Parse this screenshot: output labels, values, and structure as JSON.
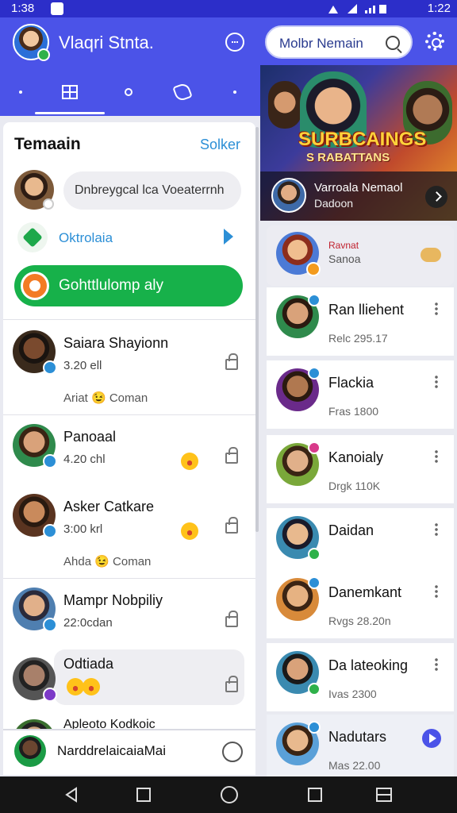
{
  "status_bar": {
    "time_left": "1:38",
    "time_right": "1:22"
  },
  "header": {
    "user_name": "Vlaqri Stnta.",
    "search_placeholder": "Molbr Nemain"
  },
  "left_panel": {
    "title": "Temaain",
    "action": "Solker",
    "status_prompt": "Dnbreygcal lca Voeaterrnh",
    "link_label": "Oktrolaia",
    "green_button": "Gohttlulomp aly",
    "chats": [
      {
        "name": "Saiara Shayionn",
        "sub": "3.20 ell",
        "preview": "Ariat 😉 Coman",
        "dot": "#2c8fd6",
        "av_skin": "#7a4a2e",
        "av_bg": "#3a2a1c"
      },
      {
        "name": "Panoaal",
        "sub": "4.20 chl",
        "preview": "",
        "dot": "#2c8fd6",
        "av_skin": "#d9a27a",
        "av_bg": "#2f8a4c"
      },
      {
        "name": "Asker Catkare",
        "sub": "3:00 krl",
        "preview": "Ahda 😉 Coman",
        "dot": "#2c8fd6",
        "av_skin": "#c98a5c",
        "av_bg": "#5a3420"
      },
      {
        "name": "Mampr Nobpiliy",
        "sub": "22:0cdan",
        "preview": "",
        "dot": "#2c8fd6",
        "av_skin": "#e1b08a",
        "av_bg": "#4f7fb0"
      },
      {
        "name": "Odtiada",
        "sub": "",
        "preview": "",
        "dot": "#7d3ac8",
        "av_skin": "#a8806a",
        "av_bg": "#555"
      },
      {
        "name": "Apleoto Kodkoic",
        "sub": "",
        "preview": "",
        "dot": "#2fb14a",
        "av_skin": "#c9a07a",
        "av_bg": "#3a6f2f"
      }
    ],
    "bottom_text": "NarddrelaicaiaMai"
  },
  "banner": {
    "title": "SURBCAINGS",
    "subtitle": "S RABATTANS",
    "channel_name": "Varroala Nemaol",
    "channel_sub": "Dadoon"
  },
  "featured": {
    "tag": "Ravnat",
    "sub": "Sanoa"
  },
  "right_list": [
    {
      "name": "Ran lliehent",
      "sub": "Relc 295.17",
      "dot": "#2c8fd6",
      "skin": "#d9a27a",
      "bg": "#2f8a4c"
    },
    {
      "name": "Flackia",
      "sub": "Fras 1800",
      "dot": "#2c8fd6",
      "skin": "#b07850",
      "bg": "#6a2a8a"
    },
    {
      "name": "Kanoialy",
      "sub": "Drgk 110K",
      "dot": "#d83a8a",
      "skin": "#e1b08a",
      "bg": "#7aa83a"
    },
    {
      "name": "Daidan",
      "sub": "",
      "dot": "#2fb14a",
      "skin": "#e8b98e",
      "bg": "#3a8ab0"
    },
    {
      "name": "Danemkant",
      "sub": "Rvgs 28.20n",
      "dot": "#2c8fd6",
      "skin": "#e6b282",
      "bg": "#d88a3a"
    },
    {
      "name": "Da lateoking",
      "sub": "Ivas 2300",
      "dot": "#2fb14a",
      "skin": "#d9a27a",
      "bg": "#3a8ab0"
    },
    {
      "name": "Nadutars",
      "sub": "Mas 22.00",
      "dot": "#2c8fd6",
      "skin": "#e8b98e",
      "bg": "#5aa0d8"
    }
  ]
}
